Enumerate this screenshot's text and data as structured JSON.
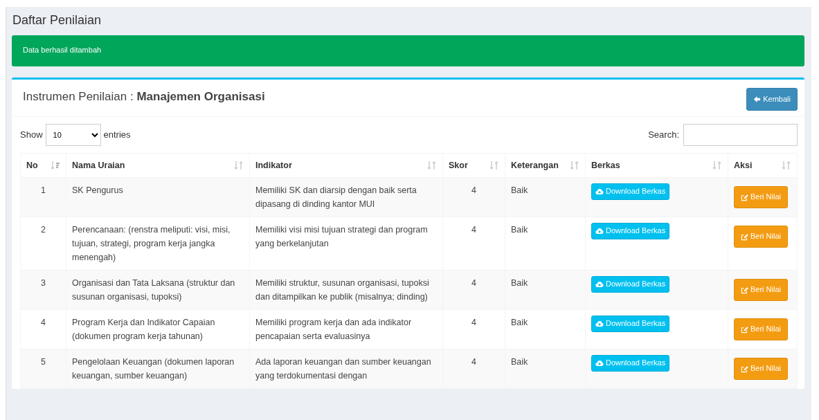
{
  "page_title": "Daftar Penilaian",
  "alert": {
    "kind": "success",
    "text": "Data berhasil ditambah"
  },
  "card": {
    "title_prefix": "Instrumen Penilaian : ",
    "title_subject": "Manajemen Organisasi",
    "back_button": "Kembali"
  },
  "length_menu": {
    "before": "Show",
    "value": "10",
    "after": "entries"
  },
  "search": {
    "label": "Search:"
  },
  "table": {
    "columns": [
      {
        "label": "No",
        "sorted": true
      },
      {
        "label": "Nama Uraian",
        "sorted": false
      },
      {
        "label": "Indikator",
        "sorted": false
      },
      {
        "label": "Skor",
        "sorted": false
      },
      {
        "label": "Keterangan",
        "sorted": false
      },
      {
        "label": "Berkas",
        "sorted": false
      },
      {
        "label": "Aksi",
        "sorted": false
      }
    ],
    "rows": [
      {
        "no": "1",
        "nama": "SK Pengurus",
        "indikator": "Memiliki SK dan diarsip dengan baik serta dipasang di dinding kantor MUI",
        "skor": "4",
        "keterangan": "Baik",
        "berkas": "Download Berkas",
        "aksi": "Beri Nilai"
      },
      {
        "no": "2",
        "nama": "Perencanaan: (renstra meliputi: visi, misi, tujuan, strategi, program kerja jangka menengah)",
        "indikator": "Memiliki visi misi tujuan strategi dan program yang berkelanjutan",
        "skor": "4",
        "keterangan": "Baik",
        "berkas": "Download Berkas",
        "aksi": "Beri Nilai"
      },
      {
        "no": "3",
        "nama": "Organisasi dan Tata Laksana (struktur dan susunan organisasi, tupoksi)",
        "indikator": "Memiliki struktur, susunan organisasi, tupoksi dan ditampilkan ke publik (misalnya; dinding)",
        "skor": "4",
        "keterangan": "Baik",
        "berkas": "Download Berkas",
        "aksi": "Beri Nilai"
      },
      {
        "no": "4",
        "nama": "Program Kerja dan Indikator Capaian (dokumen program kerja tahunan)",
        "indikator": "Memiliki program kerja dan ada indikator pencapaian serta evaluasinya",
        "skor": "4",
        "keterangan": "Baik",
        "berkas": "Download Berkas",
        "aksi": "Beri Nilai"
      },
      {
        "no": "5",
        "nama": "Pengelolaan Keuangan (dokumen laporan keuangan, sumber keuangan)",
        "indikator": "Ada laporan keuangan dan sumber keuangan yang terdokumentasi dengan",
        "skor": "4",
        "keterangan": "Baik",
        "berkas": "Download Berkas",
        "aksi": "Beri Nilai"
      }
    ]
  }
}
